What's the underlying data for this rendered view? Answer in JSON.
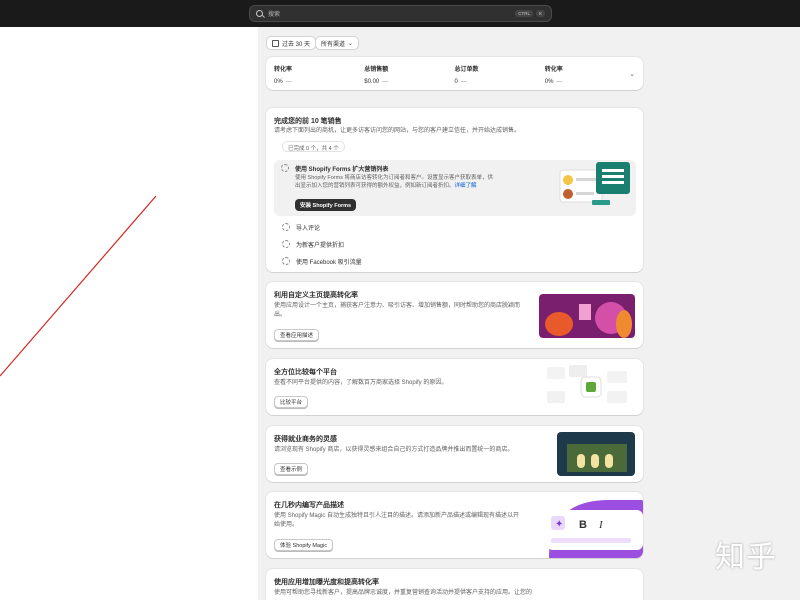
{
  "search": {
    "placeholder": "搜索",
    "shortcut_ctrl": "CTRL",
    "shortcut_key": "K"
  },
  "filters": {
    "date_range": "过去 30 天",
    "channel": "所有渠道"
  },
  "metrics": [
    {
      "label": "转化率",
      "value": "0%",
      "change": "—"
    },
    {
      "label": "总销售额",
      "value": "$0.00",
      "change": "—"
    },
    {
      "label": "总订单数",
      "value": "0",
      "change": "—"
    },
    {
      "label": "转化率",
      "value": "0%",
      "change": "—"
    }
  ],
  "onboarding": {
    "title": "完成您的前 10 笔销售",
    "description": "请考虑下面列出的商机，让更多访客访问您的网站，与您的客户建立信任，并开始达成销售。",
    "progress": "已完成 0 个，共 4 个",
    "active_task": {
      "title": "使用 Shopify Forms 扩大营销列表",
      "description_1": "使用 Shopify Forms 将商店访客转化为订阅者和客户。设置显示客户获取表单，供",
      "description_2": "出显示加入您的营销列表可获得的额外权益，例如新订阅者折扣。",
      "link": "详细了解",
      "button": "安装 Shopify Forms"
    },
    "tasks": [
      "导入评论",
      "为新客户提供折扣",
      "使用 Facebook 吸引流量"
    ]
  },
  "cards": [
    {
      "title": "利用自定义主页提高转化率",
      "desc_1": "使用应用设计一个主页，捕获客户注意力、吸引访客、增加销售额，同时帮助您的商店脱颖而",
      "desc_2": "出。",
      "button": "查看应用描述"
    },
    {
      "title": "全方位比较每个平台",
      "desc_1": "查看不同平台提供的内容，了解数百万商家选择 Shopify 的原因。",
      "button": "比较平台"
    },
    {
      "title": "获得就业商务的灵感",
      "desc_1": "请浏览现有 Shopify 商店，以获得灵感来组合自己的方式打造品牌并推出而置统一的商店。",
      "button": "查看示例"
    },
    {
      "title": "在几秒内编写产品描述",
      "desc_1": "使用 Shopify Magic 自动生成独特且引人注目的描述。请添加新产品描述或编辑现有描述以开",
      "desc_2": "始使用。",
      "button": "体验 Shopify Magic"
    },
    {
      "title": "使用应用增加曝光度和提高转化率",
      "desc_1": "使用可帮助您寻找新客户，提高品牌忠诚度，并重复营销查询活动并提供客户支持的应用。让您的"
    }
  ],
  "watermark": "知乎",
  "colors": {
    "accent": "#005bd3",
    "topbar": "#1a1a1a",
    "annotation_line": "#d4261f"
  }
}
